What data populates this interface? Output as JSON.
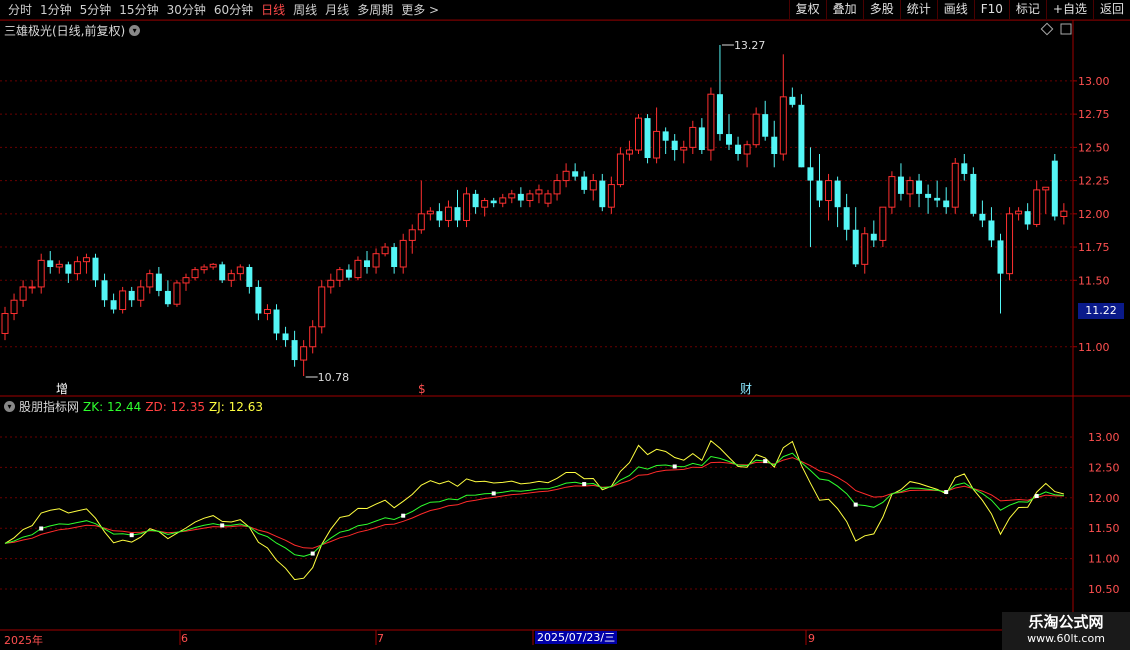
{
  "toolbar": {
    "periods": [
      "分时",
      "1分钟",
      "5分钟",
      "15分钟",
      "30分钟",
      "60分钟",
      "日线",
      "周线",
      "月线",
      "多周期",
      "更多 >"
    ],
    "active_period": "日线",
    "buttons": [
      "复权",
      "叠加",
      "多股",
      "统计",
      "画线",
      "F10",
      "标记",
      "+自选",
      "返回"
    ]
  },
  "main": {
    "title": "三雄极光(日线,前复权)",
    "price_axis": [
      "13.00",
      "12.75",
      "12.50",
      "12.25",
      "12.00",
      "11.75",
      "11.50",
      "11.00"
    ],
    "current_price": "11.22",
    "high_label": "13.27",
    "low_label": "10.78",
    "markers": [
      "增",
      "$",
      "财"
    ]
  },
  "indicator": {
    "name": "股朋指标网",
    "zk_label": "ZK: 12.44",
    "zd_label": "ZD: 12.35",
    "zj_label": "ZJ: 12.63",
    "axis": [
      "13.00",
      "12.50",
      "12.00",
      "11.50",
      "11.00",
      "10.50"
    ]
  },
  "dates": {
    "year": "2025年",
    "m6": "6",
    "m7": "7",
    "highlight": "2025/07/23/三",
    "m9": "9"
  },
  "watermark": {
    "line1": "乐淘公式网",
    "line2": "www.60lt.com"
  },
  "colors": {
    "up": "#ff3030",
    "down": "#54f6f6",
    "zk": "#2eff2e",
    "zd": "#ff2a2a",
    "zj": "#ffff40"
  },
  "chart_data": {
    "type": "candlestick",
    "ohlc": [
      [
        11.1,
        11.3,
        11.05,
        11.25
      ],
      [
        11.25,
        11.4,
        11.2,
        11.35
      ],
      [
        11.35,
        11.5,
        11.3,
        11.45
      ],
      [
        11.45,
        11.5,
        11.4,
        11.45
      ],
      [
        11.45,
        11.7,
        11.4,
        11.65
      ],
      [
        11.65,
        11.72,
        11.55,
        11.6
      ],
      [
        11.6,
        11.65,
        11.55,
        11.62
      ],
      [
        11.62,
        11.64,
        11.48,
        11.55
      ],
      [
        11.55,
        11.68,
        11.5,
        11.64
      ],
      [
        11.64,
        11.7,
        11.55,
        11.67
      ],
      [
        11.67,
        11.7,
        11.45,
        11.5
      ],
      [
        11.5,
        11.55,
        11.3,
        11.35
      ],
      [
        11.35,
        11.4,
        11.25,
        11.28
      ],
      [
        11.28,
        11.45,
        11.25,
        11.42
      ],
      [
        11.42,
        11.45,
        11.3,
        11.35
      ],
      [
        11.35,
        11.5,
        11.3,
        11.45
      ],
      [
        11.45,
        11.58,
        11.4,
        11.55
      ],
      [
        11.55,
        11.6,
        11.38,
        11.42
      ],
      [
        11.42,
        11.5,
        11.3,
        11.32
      ],
      [
        11.32,
        11.5,
        11.3,
        11.48
      ],
      [
        11.48,
        11.55,
        11.42,
        11.52
      ],
      [
        11.52,
        11.6,
        11.5,
        11.58
      ],
      [
        11.58,
        11.62,
        11.55,
        11.6
      ],
      [
        11.6,
        11.63,
        11.58,
        11.62
      ],
      [
        11.62,
        11.64,
        11.48,
        11.5
      ],
      [
        11.5,
        11.58,
        11.45,
        11.55
      ],
      [
        11.55,
        11.62,
        11.5,
        11.6
      ],
      [
        11.6,
        11.62,
        11.4,
        11.45
      ],
      [
        11.45,
        11.5,
        11.2,
        11.25
      ],
      [
        11.25,
        11.32,
        11.2,
        11.28
      ],
      [
        11.28,
        11.32,
        11.05,
        11.1
      ],
      [
        11.1,
        11.15,
        11.0,
        11.05
      ],
      [
        11.05,
        11.12,
        10.85,
        10.9
      ],
      [
        10.9,
        11.05,
        10.78,
        11.0
      ],
      [
        11.0,
        11.2,
        10.95,
        11.15
      ],
      [
        11.15,
        11.5,
        11.1,
        11.45
      ],
      [
        11.45,
        11.55,
        11.4,
        11.5
      ],
      [
        11.5,
        11.6,
        11.45,
        11.58
      ],
      [
        11.58,
        11.62,
        11.5,
        11.52
      ],
      [
        11.52,
        11.68,
        11.5,
        11.65
      ],
      [
        11.65,
        11.72,
        11.55,
        11.6
      ],
      [
        11.6,
        11.74,
        11.55,
        11.7
      ],
      [
        11.7,
        11.78,
        11.68,
        11.75
      ],
      [
        11.75,
        11.78,
        11.55,
        11.6
      ],
      [
        11.6,
        11.85,
        11.55,
        11.8
      ],
      [
        11.8,
        11.92,
        11.7,
        11.88
      ],
      [
        11.88,
        12.25,
        11.85,
        12.0
      ],
      [
        12.0,
        12.05,
        11.95,
        12.02
      ],
      [
        12.02,
        12.08,
        11.9,
        11.95
      ],
      [
        11.95,
        12.1,
        11.9,
        12.05
      ],
      [
        12.05,
        12.18,
        11.9,
        11.95
      ],
      [
        11.95,
        12.2,
        11.9,
        12.15
      ],
      [
        12.15,
        12.18,
        12.0,
        12.05
      ],
      [
        12.05,
        12.12,
        11.98,
        12.1
      ],
      [
        12.1,
        12.12,
        12.05,
        12.08
      ],
      [
        12.08,
        12.15,
        12.05,
        12.12
      ],
      [
        12.12,
        12.18,
        12.08,
        12.15
      ],
      [
        12.15,
        12.2,
        12.05,
        12.1
      ],
      [
        12.1,
        12.18,
        12.05,
        12.15
      ],
      [
        12.15,
        12.22,
        12.08,
        12.18
      ],
      [
        12.08,
        12.18,
        12.05,
        12.15
      ],
      [
        12.15,
        12.3,
        12.1,
        12.25
      ],
      [
        12.25,
        12.38,
        12.2,
        12.32
      ],
      [
        12.32,
        12.38,
        12.25,
        12.28
      ],
      [
        12.28,
        12.32,
        12.15,
        12.18
      ],
      [
        12.18,
        12.3,
        12.1,
        12.25
      ],
      [
        12.25,
        12.3,
        12.02,
        12.05
      ],
      [
        12.05,
        12.28,
        12.0,
        12.22
      ],
      [
        12.22,
        12.5,
        12.2,
        12.45
      ],
      [
        12.45,
        12.55,
        12.4,
        12.48
      ],
      [
        12.48,
        12.75,
        12.45,
        12.72
      ],
      [
        12.72,
        12.75,
        12.38,
        12.42
      ],
      [
        12.42,
        12.8,
        12.38,
        12.62
      ],
      [
        12.62,
        12.65,
        12.45,
        12.55
      ],
      [
        12.55,
        12.6,
        12.4,
        12.48
      ],
      [
        12.48,
        12.55,
        12.38,
        12.5
      ],
      [
        12.5,
        12.7,
        12.45,
        12.65
      ],
      [
        12.65,
        12.72,
        12.45,
        12.48
      ],
      [
        12.48,
        12.95,
        12.4,
        12.9
      ],
      [
        12.9,
        13.27,
        12.55,
        12.6
      ],
      [
        12.6,
        12.75,
        12.48,
        12.52
      ],
      [
        12.52,
        12.58,
        12.4,
        12.45
      ],
      [
        12.45,
        12.55,
        12.35,
        12.52
      ],
      [
        12.52,
        12.8,
        12.5,
        12.75
      ],
      [
        12.75,
        12.85,
        12.55,
        12.58
      ],
      [
        12.58,
        12.7,
        12.35,
        12.45
      ],
      [
        12.45,
        13.2,
        12.4,
        12.88
      ],
      [
        12.88,
        12.95,
        12.8,
        12.82
      ],
      [
        12.82,
        12.9,
        12.35,
        12.35
      ],
      [
        12.35,
        12.5,
        11.75,
        12.25
      ],
      [
        12.25,
        12.45,
        12.05,
        12.1
      ],
      [
        12.1,
        12.3,
        11.95,
        12.25
      ],
      [
        12.25,
        12.28,
        11.9,
        12.05
      ],
      [
        12.05,
        12.15,
        11.8,
        11.88
      ],
      [
        11.88,
        12.05,
        11.6,
        11.62
      ],
      [
        11.62,
        11.9,
        11.55,
        11.85
      ],
      [
        11.85,
        11.95,
        11.75,
        11.8
      ],
      [
        11.8,
        12.05,
        11.75,
        12.05
      ],
      [
        12.05,
        12.32,
        12.0,
        12.28
      ],
      [
        12.28,
        12.38,
        12.1,
        12.15
      ],
      [
        12.15,
        12.28,
        12.05,
        12.25
      ],
      [
        12.25,
        12.3,
        12.05,
        12.15
      ],
      [
        12.15,
        12.22,
        12.0,
        12.12
      ],
      [
        12.12,
        12.25,
        12.05,
        12.1
      ],
      [
        12.1,
        12.2,
        12.0,
        12.05
      ],
      [
        12.05,
        12.42,
        12.0,
        12.38
      ],
      [
        12.38,
        12.45,
        12.25,
        12.3
      ],
      [
        12.3,
        12.35,
        11.98,
        12.0
      ],
      [
        12.0,
        12.1,
        11.9,
        11.95
      ],
      [
        11.95,
        12.05,
        11.75,
        11.8
      ],
      [
        11.8,
        11.85,
        11.25,
        11.55
      ],
      [
        11.55,
        12.05,
        11.5,
        12.0
      ],
      [
        12.0,
        12.05,
        11.95,
        12.02
      ],
      [
        12.02,
        12.08,
        11.88,
        11.92
      ],
      [
        11.92,
        12.25,
        11.9,
        12.18
      ],
      [
        12.18,
        12.2,
        12.0,
        12.2
      ],
      [
        12.4,
        12.45,
        11.95,
        11.98
      ],
      [
        11.98,
        12.08,
        11.92,
        12.02
      ]
    ],
    "indicator": {
      "ZK": "green",
      "ZD": "red",
      "ZJ": "yellow"
    }
  }
}
